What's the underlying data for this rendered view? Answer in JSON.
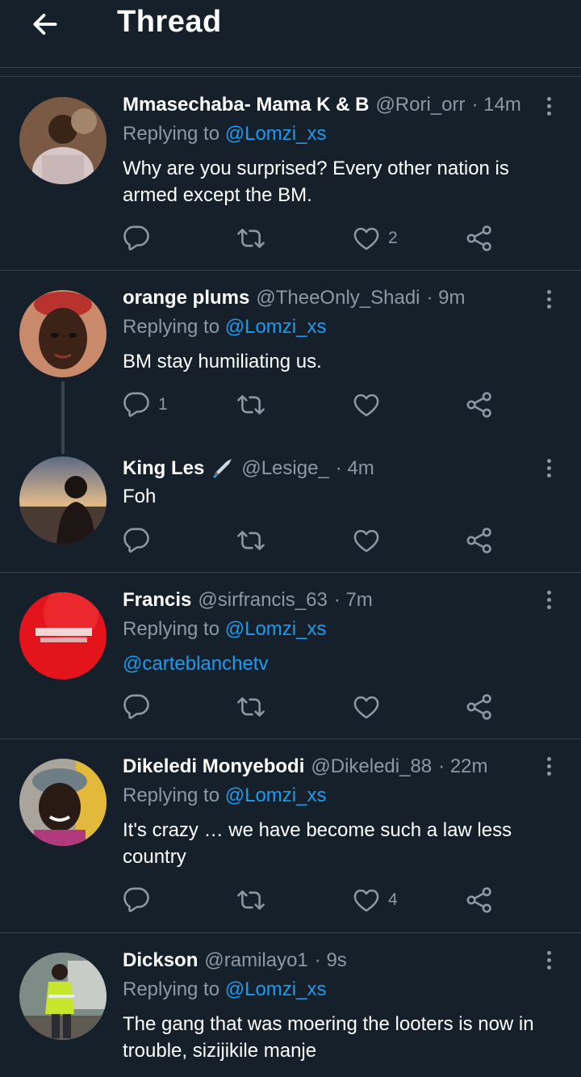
{
  "header": {
    "title": "Thread",
    "back_icon": "arrow-left-icon"
  },
  "colors": {
    "background": "#15202b",
    "divider": "#38444d",
    "secondary_text": "#8b98a5",
    "link": "#1d9bf0"
  },
  "tweets": [
    {
      "name": "Mmasechaba- Mama K & B",
      "handle": "@Rori_orr",
      "time": "· 14m",
      "replying_prefix": "Replying to",
      "replying_handle": "@Lomzi_xs",
      "text": "Why are you surprised? Every other nation is armed except the BM.",
      "reply_count": "",
      "like_count": "2"
    },
    {
      "name": "orange plums",
      "handle": "@TheeOnly_Shadi",
      "time": "· 9m",
      "replying_prefix": "Replying to",
      "replying_handle": "@Lomzi_xs",
      "text": "BM stay humiliating us.",
      "reply_count": "1",
      "like_count": ""
    },
    {
      "name": "King Les",
      "handle": "@Lesige_",
      "time": "· 4m",
      "name_emoji": "dagger-icon",
      "text": "Foh",
      "reply_count": "",
      "like_count": ""
    },
    {
      "name": "Francis",
      "handle": "@sirfrancis_63",
      "time": "· 7m",
      "replying_prefix": "Replying to",
      "replying_handle": "@Lomzi_xs",
      "text": "@carteblanchetv",
      "reply_count": "",
      "like_count": ""
    },
    {
      "name": "Dikeledi Monyebodi",
      "handle": "@Dikeledi_88",
      "time": "· 22m",
      "replying_prefix": "Replying to",
      "replying_handle": "@Lomzi_xs",
      "text": "It's crazy … we have become such a law less country",
      "reply_count": "",
      "like_count": "4"
    },
    {
      "name": "Dickson",
      "handle": "@ramilayo1",
      "time": "· 9s",
      "replying_prefix": "Replying to",
      "replying_handle": "@Lomzi_xs",
      "text": "The gang that was moering the looters is now in trouble,  sizijikile manje"
    }
  ]
}
